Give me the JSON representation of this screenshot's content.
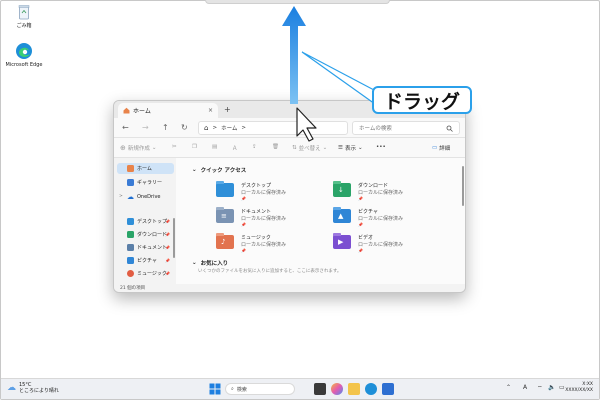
{
  "desktop": {
    "icons": [
      {
        "label": "ごみ箱",
        "icon": "recycle-bin-icon"
      },
      {
        "label": "Microsoft Edge",
        "icon": "edge-icon"
      }
    ]
  },
  "annotation": {
    "callout_text": "ドラッグ",
    "arrow_color": "#2b8ee8"
  },
  "explorer": {
    "tab_title": "ホーム",
    "tab_close": "×",
    "new_tab": "+",
    "nav": {
      "back": "←",
      "forward": "→",
      "up": "↑",
      "refresh": "↻"
    },
    "address": {
      "home_glyph": "⌂",
      "sep1": ">",
      "crumb": "ホーム",
      "sep2": ">"
    },
    "search_placeholder": "ホームの検索",
    "command_bar": {
      "new_label": "新規作成",
      "sort_label": "並べ替え",
      "view_label": "表示",
      "more": "•••",
      "details_label": "詳細"
    },
    "sidebar": {
      "items": [
        {
          "label": "ホーム",
          "color": "#e8834a",
          "selected": true
        },
        {
          "label": "ギャラリー",
          "color": "#3a7bd5"
        },
        {
          "label": "OneDrive",
          "color": "#1f6fd1",
          "chevron": ">"
        }
      ],
      "pinned": [
        {
          "label": "デスクトップ",
          "color": "#2f8fd8"
        },
        {
          "label": "ダウンロード",
          "color": "#2aa468"
        },
        {
          "label": "ドキュメント",
          "color": "#5b7fa8"
        },
        {
          "label": "ピクチャ",
          "color": "#2f86d6"
        },
        {
          "label": "ミュージック",
          "color": "#e25d43"
        }
      ],
      "pin_glyph": "📌"
    },
    "quick_access": {
      "title": "クイック アクセス",
      "toggle": "⌄",
      "folders": [
        {
          "name": "デスクトップ",
          "sub": "ローカルに保存済み",
          "color": "#2f8fd8",
          "glyph": ""
        },
        {
          "name": "ダウンロード",
          "sub": "ローカルに保存済み",
          "color": "#2aa468",
          "glyph": "↓"
        },
        {
          "name": "ドキュメント",
          "sub": "ローカルに保存済み",
          "color": "#7a93b3",
          "glyph": "≡"
        },
        {
          "name": "ピクチャ",
          "sub": "ローカルに保存済み",
          "color": "#2f86d6",
          "glyph": "▲"
        },
        {
          "name": "ミュージック",
          "sub": "ローカルに保存済み",
          "color": "#e2734f",
          "glyph": "♪"
        },
        {
          "name": "ビデオ",
          "sub": "ローカルに保存済み",
          "color": "#7b4fd1",
          "glyph": "▶"
        }
      ],
      "pin_glyph": "📌"
    },
    "favorites": {
      "title": "お気に入り",
      "toggle": "⌄",
      "empty_text": "いくつかのファイルをお気に入りに追加すると、ここに表示されます。"
    },
    "status": "21 個の項目"
  },
  "taskbar": {
    "weather_temp": "15°C",
    "weather_desc": "ところにより晴れ",
    "search_placeholder": "検索",
    "ime_label": "A",
    "clock_time": "X:XX",
    "clock_date": "XXXX/XX/XX"
  }
}
